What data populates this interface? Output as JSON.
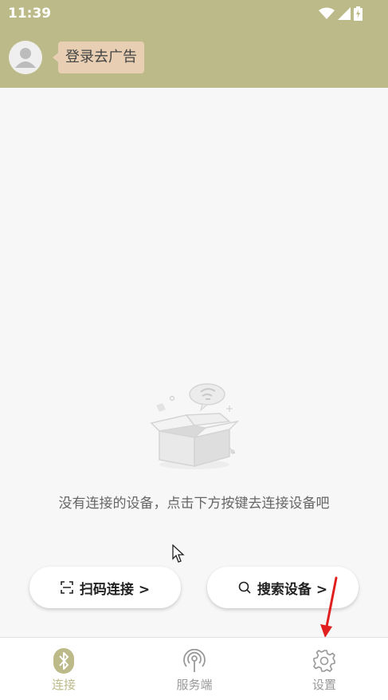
{
  "status_bar": {
    "time": "11:39"
  },
  "header": {
    "login_bubble": "登录去广告"
  },
  "empty_state": {
    "message": "没有连接的设备，点击下方按键去连接设备吧"
  },
  "actions": {
    "scan_label": "扫码连接 >",
    "search_label": "搜索设备 >"
  },
  "tabs": [
    {
      "label": "连接",
      "icon": "bluetooth-icon",
      "active": true
    },
    {
      "label": "服务端",
      "icon": "broadcast-icon",
      "active": false
    },
    {
      "label": "设置",
      "icon": "gear-icon",
      "active": false
    }
  ],
  "colors": {
    "accent": "#bbba88",
    "bubble": "#e8cfb3",
    "arrow": "#e0201e"
  }
}
